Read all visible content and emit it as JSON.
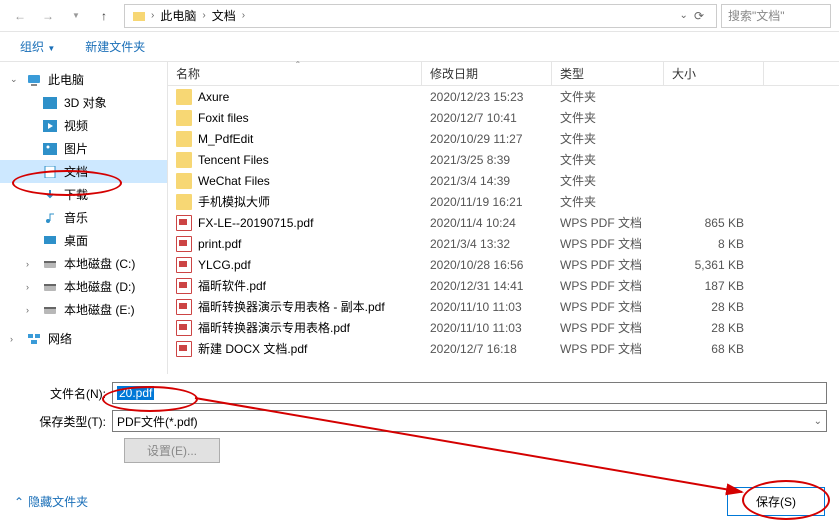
{
  "breadcrumb": {
    "root": "此电脑",
    "folder": "文档"
  },
  "search": {
    "placeholder": "搜索\"文档\""
  },
  "subbar": {
    "organize": "组织",
    "newfolder": "新建文件夹"
  },
  "columns": {
    "name": "名称",
    "date": "修改日期",
    "type": "类型",
    "size": "大小"
  },
  "sidebar": {
    "root": "此电脑",
    "items": [
      {
        "label": "3D 对象"
      },
      {
        "label": "视频"
      },
      {
        "label": "图片"
      },
      {
        "label": "文档",
        "selected": true
      },
      {
        "label": "下载"
      },
      {
        "label": "音乐"
      },
      {
        "label": "桌面"
      },
      {
        "label": "本地磁盘 (C:)"
      },
      {
        "label": "本地磁盘 (D:)"
      },
      {
        "label": "本地磁盘 (E:)"
      }
    ],
    "network": "网络"
  },
  "files": [
    {
      "name": "Axure",
      "date": "2020/12/23 15:23",
      "type": "文件夹",
      "size": "",
      "kind": "folder"
    },
    {
      "name": "Foxit files",
      "date": "2020/12/7 10:41",
      "type": "文件夹",
      "size": "",
      "kind": "folder"
    },
    {
      "name": "M_PdfEdit",
      "date": "2020/10/29 11:27",
      "type": "文件夹",
      "size": "",
      "kind": "folder"
    },
    {
      "name": "Tencent Files",
      "date": "2021/3/25 8:39",
      "type": "文件夹",
      "size": "",
      "kind": "folder"
    },
    {
      "name": "WeChat Files",
      "date": "2021/3/4 14:39",
      "type": "文件夹",
      "size": "",
      "kind": "folder"
    },
    {
      "name": "手机模拟大师",
      "date": "2020/11/19 16:21",
      "type": "文件夹",
      "size": "",
      "kind": "folder"
    },
    {
      "name": "FX-LE--20190715.pdf",
      "date": "2020/11/4 10:24",
      "type": "WPS PDF 文档",
      "size": "865 KB",
      "kind": "pdf"
    },
    {
      "name": "print.pdf",
      "date": "2021/3/4 13:32",
      "type": "WPS PDF 文档",
      "size": "8 KB",
      "kind": "pdf"
    },
    {
      "name": "YLCG.pdf",
      "date": "2020/10/28 16:56",
      "type": "WPS PDF 文档",
      "size": "5,361 KB",
      "kind": "pdf"
    },
    {
      "name": "福昕软件.pdf",
      "date": "2020/12/31 14:41",
      "type": "WPS PDF 文档",
      "size": "187 KB",
      "kind": "pdf"
    },
    {
      "name": "福昕转换器演示专用表格 - 副本.pdf",
      "date": "2020/11/10 11:03",
      "type": "WPS PDF 文档",
      "size": "28 KB",
      "kind": "pdf"
    },
    {
      "name": "福昕转换器演示专用表格.pdf",
      "date": "2020/11/10 11:03",
      "type": "WPS PDF 文档",
      "size": "28 KB",
      "kind": "pdf"
    },
    {
      "name": "新建 DOCX 文档.pdf",
      "date": "2020/12/7 16:18",
      "type": "WPS PDF 文档",
      "size": "68 KB",
      "kind": "pdf"
    }
  ],
  "filename": {
    "label": "文件名(N):",
    "value": "20.pdf"
  },
  "filetype": {
    "label": "保存类型(T):",
    "value": "PDF文件(*.pdf)"
  },
  "settings_btn": "设置(E)...",
  "hide_folders": "隐藏文件夹",
  "save_btn": "保存(S)"
}
